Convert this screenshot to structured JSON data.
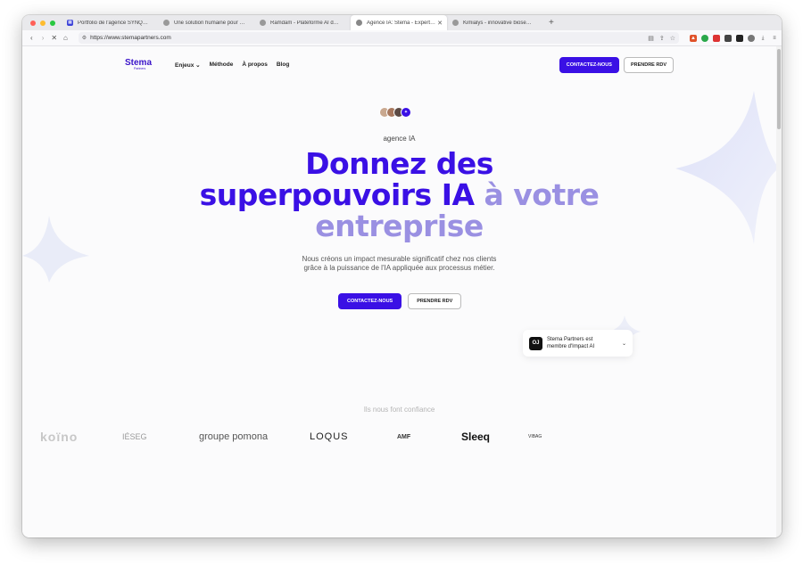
{
  "browser": {
    "tabs": [
      {
        "title": "Portfolio de l'agence SYNQRO",
        "icon": "synqro-favicon",
        "color": "#3a40d8",
        "active": false
      },
      {
        "title": "Une solution humaine pour dévelo",
        "icon": "globe-favicon",
        "color": "#888888",
        "active": false
      },
      {
        "title": "Ramdam - Plateforme AI de vidéo",
        "icon": "ramdam-favicon",
        "color": "#888888",
        "active": false
      },
      {
        "title": "Agence IA: Stema - Experts en",
        "icon": "stema-favicon",
        "color": "#888888",
        "active": true
      },
      {
        "title": "Kimialys - innovative biosensing s",
        "icon": "globe-favicon",
        "color": "#888888",
        "active": false
      }
    ],
    "url": "https://www.stemapartners.com"
  },
  "site": {
    "logo_main": "Stema",
    "logo_sub": "Partners",
    "menu": [
      "Enjeux",
      "Méthode",
      "À propos",
      "Blog"
    ],
    "cta_primary": "CONTACTEZ-NOUS",
    "cta_secondary": "PRENDRE RDV"
  },
  "hero": {
    "eyebrow": "agence IA",
    "headline_line1": "Donnez des",
    "headline_line2_dark": "superpouvoirs IA",
    "headline_line2_light": "à votre",
    "headline_line3": "entreprise",
    "subtitle_line1": "Nous créons un impact mesurable significatif chez nos clients",
    "subtitle_line2": "grâce à la puissance de l'IA appliquée aux processus métier.",
    "cta_primary": "CONTACTEZ-NOUS",
    "cta_secondary": "PRENDRE RDV"
  },
  "impact_badge": {
    "logo": "OJ",
    "line1": "Stema Partners est",
    "line2": "membre d'Impact AI"
  },
  "trust": {
    "heading": "Ils nous font confiance",
    "logos": [
      "koïno",
      "IÉSEG",
      "groupe pomona",
      "LOQUS",
      "AMF",
      "Sleeq",
      "VIBAG"
    ]
  },
  "colors": {
    "brand": "#3a10e5",
    "brand_light": "#9a90e2"
  }
}
